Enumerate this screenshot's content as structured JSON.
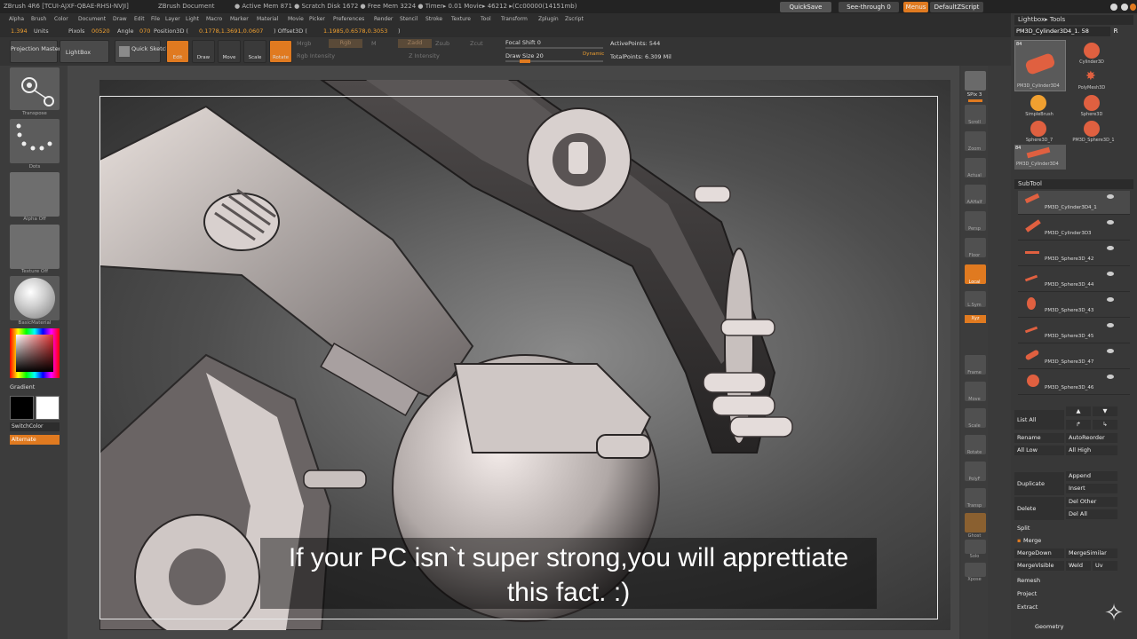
{
  "title": {
    "app": "ZBrush 4R6 [TCUI-AJXF-QBAE-RHSI-NVJI]",
    "doc": "ZBrush Document",
    "mem": "● Active Mem 871 ● Scratch Disk 1672 ● Free Mem 3224 ● Timer▸ 0.01  Movie▸ 46212 ▸(Cc00000(14151mb)",
    "quicksave": "QuickSave",
    "seethrough": "See-through  0",
    "menus": "Menus",
    "defaultzscript": "DefaultZScript"
  },
  "menu": [
    "Alpha",
    "Brush",
    "Color",
    "Document",
    "Draw",
    "Edit",
    "File",
    "Layer",
    "Light",
    "Macro",
    "Marker",
    "Material",
    "Movie",
    "Picker",
    "Preferences",
    "Render",
    "Stencil",
    "Stroke",
    "Texture",
    "Tool",
    "Transform",
    "Zplugin",
    "Zscript"
  ],
  "info": {
    "units_val": "1.394",
    "units": "Units",
    "pixols_label": "Pixols",
    "pixols": "00520",
    "angle_label": "Angle",
    "angle": "070",
    "position_label": "Position3D (",
    "position": "0.1778,1.3691,0.0607",
    "offset_label": ") Offset3D (",
    "offset": "1.1985,0.6578,0.3053",
    "close": ")"
  },
  "toolbar": {
    "projection": "Projection Master",
    "lightbox": "LightBox",
    "quicksketch": "Quick Sketch",
    "edit": "Edit",
    "draw": "Draw",
    "move": "Move",
    "scale": "Scale",
    "rotate": "Rotate",
    "mrgb": "Mrgb",
    "rgb": "Rgb",
    "m": "M",
    "zadd": "Zadd",
    "zsub": "Zsub",
    "zcut": "Zcut",
    "rgb_intensity": "Rgb Intensity",
    "z_intensity": "Z Intensity",
    "focal_shift": "Focal Shift 0",
    "draw_size": "Draw Size 20",
    "dynamic": "Dynamic",
    "active_points": "ActivePoints: 544",
    "total_points": "TotalPoints: 6.309 Mil"
  },
  "left": {
    "transpose": "Transpose",
    "dots": "Dots",
    "alpha": "Alpha Off",
    "texture": "Texture Off",
    "material": "BasicMaterial",
    "gradient": "Gradient",
    "switchcolor": "SwitchColor",
    "alternate": "Alternate"
  },
  "right_shelf": [
    "BPR",
    "SPix 3",
    "Scroll",
    "Zoom",
    "Actual",
    "AAHalf",
    "Persp",
    "Floor",
    "Local",
    "L.Sym",
    "Xyz",
    "Frame",
    "Move",
    "Scale",
    "Rotate",
    "PolyF",
    "Transp",
    "Ghost",
    "Solo",
    "Xpose"
  ],
  "lightbox_tools": {
    "header": "Lightbox▸ Tools",
    "current": "PM3D_Cylinder3D4_1. 58",
    "r": "R",
    "items": [
      "PM3D_Cylinder3D4",
      "Cylinder3D",
      "PolyMesh3D",
      "SimpleBrush",
      "Sphere3D",
      "Sphere3D_7",
      "PM3D_Sphere3D_1",
      "PM3D_Cylinder3D4"
    ],
    "badge": "84"
  },
  "subtool": {
    "header": "SubTool",
    "items": [
      "PM3D_Cylinder3D4_1",
      "PM3D_Cylinder3D3",
      "PM3D_Sphere3D_42",
      "PM3D_Sphere3D_44",
      "PM3D_Sphere3D_43",
      "PM3D_Sphere3D_45",
      "PM3D_Sphere3D_47",
      "PM3D_Sphere3D_46"
    ],
    "list_all": "List  All",
    "rename": "Rename",
    "autoreorder": "AutoReorder",
    "all_low": "All Low",
    "all_high": "All High",
    "duplicate": "Duplicate",
    "append": "Append",
    "insert": "Insert",
    "delete": "Delete",
    "del_other": "Del Other",
    "del_all": "Del All",
    "split": "Split",
    "merge": "Merge",
    "merge_down": "MergeDown",
    "merge_similar": "MergeSimilar",
    "merge_visible": "MergeVisible",
    "weld": "Weld",
    "uv": "Uv",
    "remesh": "Remesh",
    "project": "Project",
    "extract": "Extract",
    "geometry": "Geometry"
  },
  "subtitle": {
    "line1": "If your PC isn`t super strong,you will apprettiate",
    "line2": "this fact. :)"
  }
}
